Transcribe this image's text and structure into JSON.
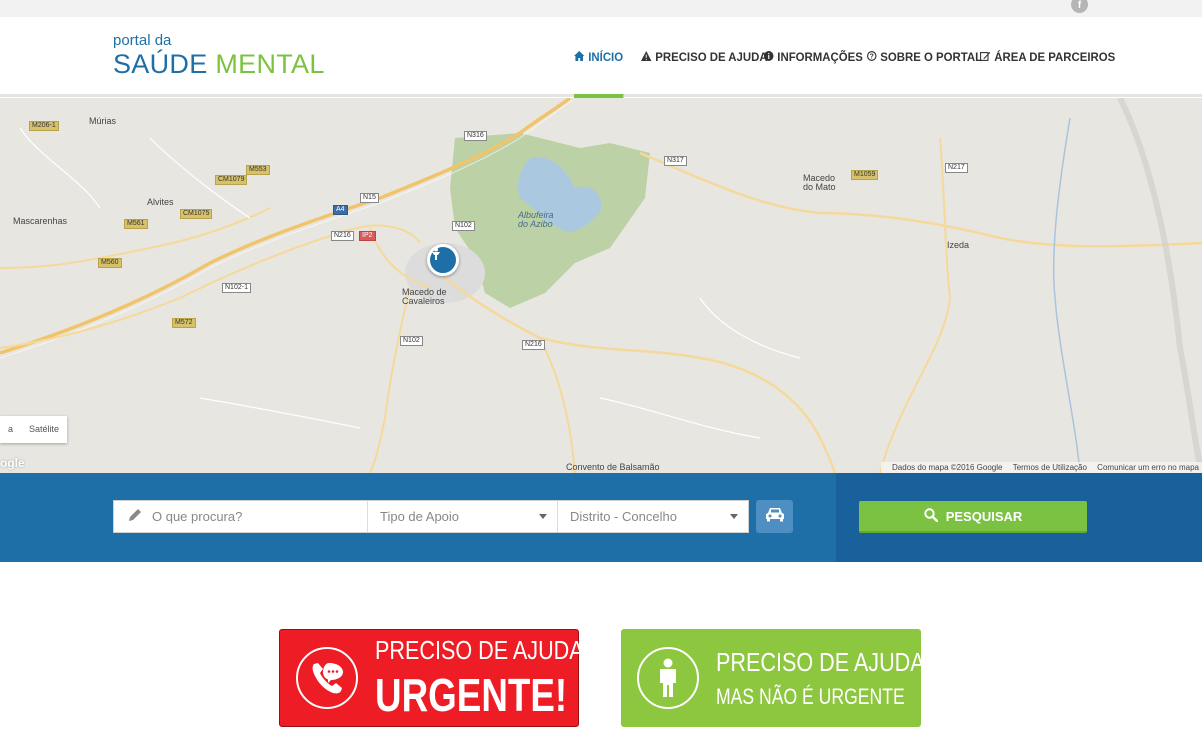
{
  "header": {
    "logo_small": "portal da",
    "logo_big_a": "SAÚDE",
    "logo_big_b": "MENTAL",
    "nav": [
      {
        "label": "INÍCIO",
        "icon": "home-icon",
        "active": true
      },
      {
        "label": "PRECISO DE AJUDA",
        "icon": "warning-icon"
      },
      {
        "label": "INFORMAÇÕES",
        "icon": "info-icon"
      },
      {
        "label": "SOBRE O PORTAL",
        "icon": "question-icon"
      },
      {
        "label": "ÁREA DE PARCEIROS",
        "icon": "edit-icon"
      }
    ]
  },
  "map": {
    "places": [
      "Múrias",
      "Alvites",
      "Mascarenhas",
      "Macedo de Cavaleiros",
      "Albufeira do Azibo",
      "Macedo do Mato",
      "Izeda",
      "Convento de Balsamão"
    ],
    "place_lines": {
      "macedo_cav_1": "Macedo de",
      "macedo_cav_2": "Cavaleiros",
      "albufeira_1": "Albufeira",
      "albufeira_2": "do Azibo",
      "macedo_mato_1": "Macedo",
      "macedo_mato_2": "do Mato"
    },
    "roads": [
      "M206-1",
      "N316",
      "M553",
      "CM1079",
      "N15",
      "A4",
      "M561",
      "CM1075",
      "N102",
      "N216",
      "IP2",
      "M560",
      "N102-1",
      "M572",
      "N317",
      "M1059",
      "N217",
      "N216",
      "N102"
    ],
    "type_map": "a",
    "type_satellite": "Satélite",
    "google": "ogle",
    "attribution": [
      "Dados do mapa ©2016 Google",
      "Termos de Utilização",
      "Comunicar um erro no mapa"
    ],
    "pin_icon": "person-pin-icon"
  },
  "search": {
    "query_placeholder": "O que procura?",
    "tipo_placeholder": "Tipo de Apoio",
    "distrito_placeholder": "Distrito - Concelho",
    "button_label": "PESQUISAR"
  },
  "cta": {
    "urgent_l1": "PRECISO DE AJUDA",
    "urgent_l2": "URGENTE!",
    "non_urgent_l1": "PRECISO DE AJUDA",
    "non_urgent_l2": "MAS NÃO É URGENTE"
  },
  "colors": {
    "brand_blue": "#1e6fa8",
    "brand_green": "#7cc242",
    "urgent_red": "#ee1c24"
  }
}
